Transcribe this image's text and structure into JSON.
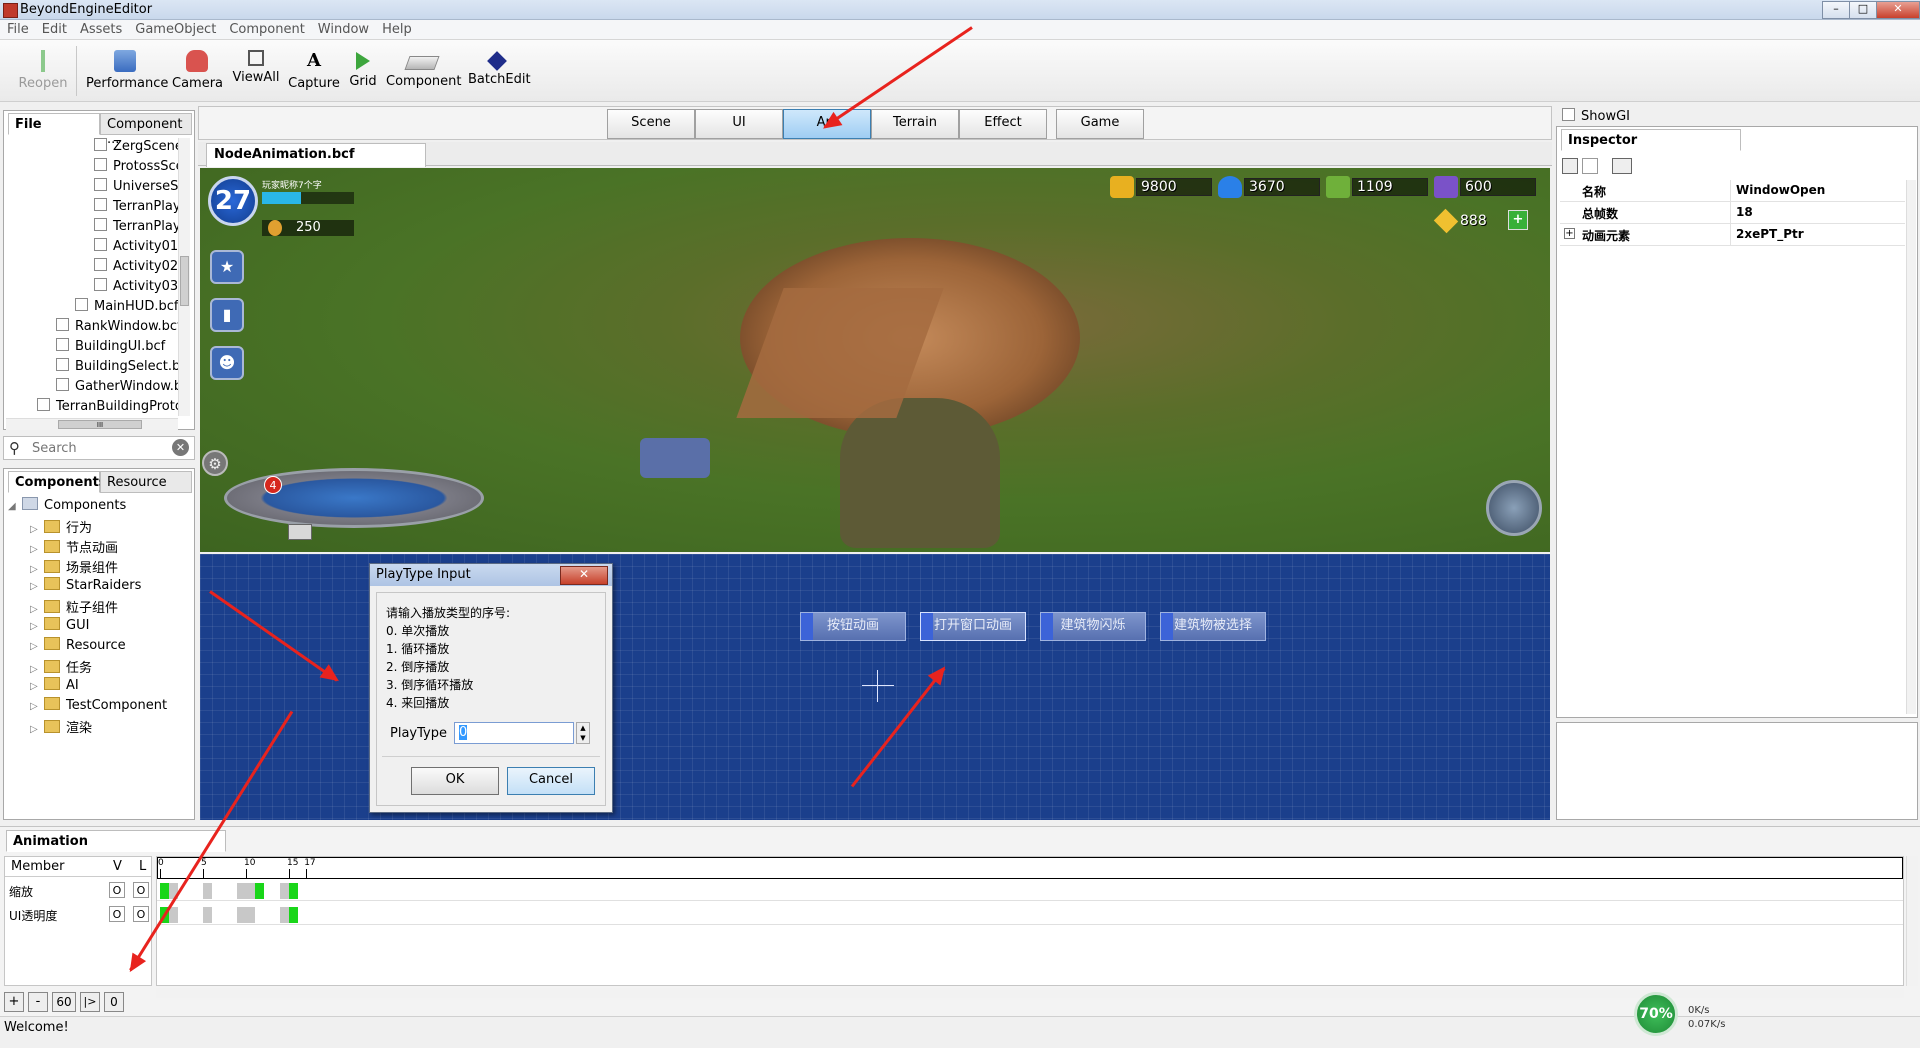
{
  "app": {
    "title": "BeyondEngineEditor"
  },
  "menu": [
    "File",
    "Edit",
    "Assets",
    "GameObject",
    "Component",
    "Window",
    "Help"
  ],
  "toolbar": {
    "reopen": "Reopen",
    "performance": "Performance",
    "camera": "Camera",
    "viewall": "ViewAll",
    "capture": "Capture",
    "capture_glyph": "A",
    "grid": "Grid",
    "component": "Component",
    "batchedit": "BatchEdit"
  },
  "file_panel": {
    "tabs": [
      "File",
      "Component ..."
    ],
    "files": [
      "ZergScene",
      "ProtossSce",
      "UniverseSc",
      "TerranPlay",
      "TerranPlay",
      "Activity01.b",
      "Activity02.b",
      "Activity03.b",
      "MainHUD.bcf",
      "RankWindow.bcf",
      "BuildingUI.bcf",
      "BuildingSelect.bcf",
      "GatherWindow.bc",
      "TerranBuildingProtot"
    ],
    "scroll_mark": "III",
    "search_placeholder": "Search"
  },
  "components_panel": {
    "tabs": [
      "Components",
      "Resource"
    ],
    "root": "Components",
    "items": [
      "行为",
      "节点动画",
      "场景组件",
      "StarRaiders",
      "粒子组件",
      "GUI",
      "Resource",
      "任务",
      "AI",
      "TestComponent",
      "渲染"
    ]
  },
  "mode_tabs": [
    "Scene",
    "UI",
    "Ani",
    "Terrain",
    "Effect",
    "Game"
  ],
  "selected_mode": "Ani",
  "doc_tab": "NodeAnimation.bcf",
  "game_hud": {
    "level": "27",
    "player_name": "玩家昵称7个字",
    "medals": "250",
    "gold": "9800",
    "crystal": "3670",
    "gas": "1109",
    "cube": "600",
    "diamond": "888",
    "notify": "4"
  },
  "ui_buttons": [
    "按钮动画",
    "打开窗口动画",
    "建筑物闪烁",
    "建筑物被选择"
  ],
  "dialog": {
    "title": "PlayType Input",
    "close": "✕",
    "prompt": "请输入播放类型的序号:",
    "options": [
      "0. 单次播放",
      "1. 循环播放",
      "2. 倒序播放",
      "3. 倒序循环播放",
      "4. 来回播放"
    ],
    "field_label": "PlayType",
    "field_value": "0",
    "ok": "OK",
    "cancel": "Cancel"
  },
  "inspector": {
    "showgi": "ShowGI",
    "tab": "Inspector",
    "rows": [
      {
        "key": "名称",
        "value": "WindowOpen"
      },
      {
        "key": "总帧数",
        "value": "18"
      },
      {
        "key": "动画元素",
        "value": "2xePT_Ptr"
      }
    ],
    "expand_glyph": "+"
  },
  "animation": {
    "tab": "Animation",
    "headers": {
      "member": "Member",
      "v": "V",
      "l": "L"
    },
    "members": [
      "缩放",
      "UI透明度"
    ],
    "flag": "O",
    "ruler": [
      "0",
      "5",
      "10",
      "15",
      "17"
    ],
    "controls": [
      "+",
      "-",
      "60",
      "|>",
      "0"
    ],
    "keyframes": [
      {
        "row": 0,
        "frame": 0,
        "color": "#19d619"
      },
      {
        "row": 0,
        "frame": 11,
        "color": "#19d619"
      },
      {
        "row": 0,
        "frame": 15,
        "color": "#19d619"
      },
      {
        "row": 1,
        "frame": 0,
        "color": "#19d619"
      },
      {
        "row": 1,
        "frame": 15,
        "color": "#19d619"
      }
    ],
    "gray_frames": [
      1,
      5,
      9,
      10,
      14
    ]
  },
  "status": {
    "text": "Welcome!"
  },
  "tray": {
    "percent": "70%",
    "up": "0K/s",
    "down": "0.07K/s"
  }
}
